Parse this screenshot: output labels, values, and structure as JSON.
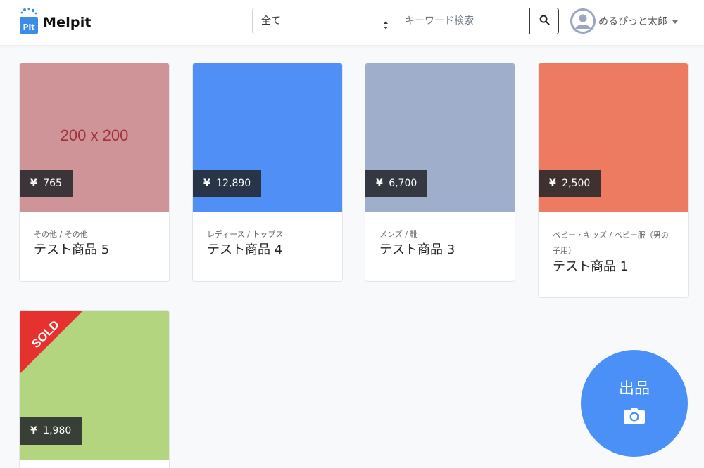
{
  "brand": {
    "name": "Melpit",
    "logo_text": "Pit"
  },
  "search": {
    "category_selected": "全て",
    "keyword_placeholder": "キーワード検索"
  },
  "user": {
    "name": "めるぴっと太郎"
  },
  "items": [
    {
      "price": "765",
      "category": "その他 / その他",
      "title": "テスト商品 5",
      "image_color": "#cf9497",
      "image_text": "200 x 200",
      "sold": false
    },
    {
      "price": "12,890",
      "category": "レディース / トップス",
      "title": "テスト商品 4",
      "image_color": "#4f8ff6",
      "sold": false
    },
    {
      "price": "6,700",
      "category": "メンズ / 靴",
      "title": "テスト商品 3",
      "image_color": "#9eaecb",
      "sold": false
    },
    {
      "price": "2,500",
      "category": "ベビー・キッズ / ベビー服（男の子用）",
      "title": "テスト商品 1",
      "image_color": "#ed7b62",
      "sold": false
    },
    {
      "price": "1,980",
      "category": "",
      "title": "",
      "image_color": "#b4d57f",
      "sold": true,
      "sold_label": "SOLD"
    }
  ],
  "currency_symbol": "¥",
  "fab": {
    "label": "出品",
    "icon": "camera-icon"
  },
  "colors": {
    "accent": "#4a90f7",
    "sold": "#e6322f"
  }
}
